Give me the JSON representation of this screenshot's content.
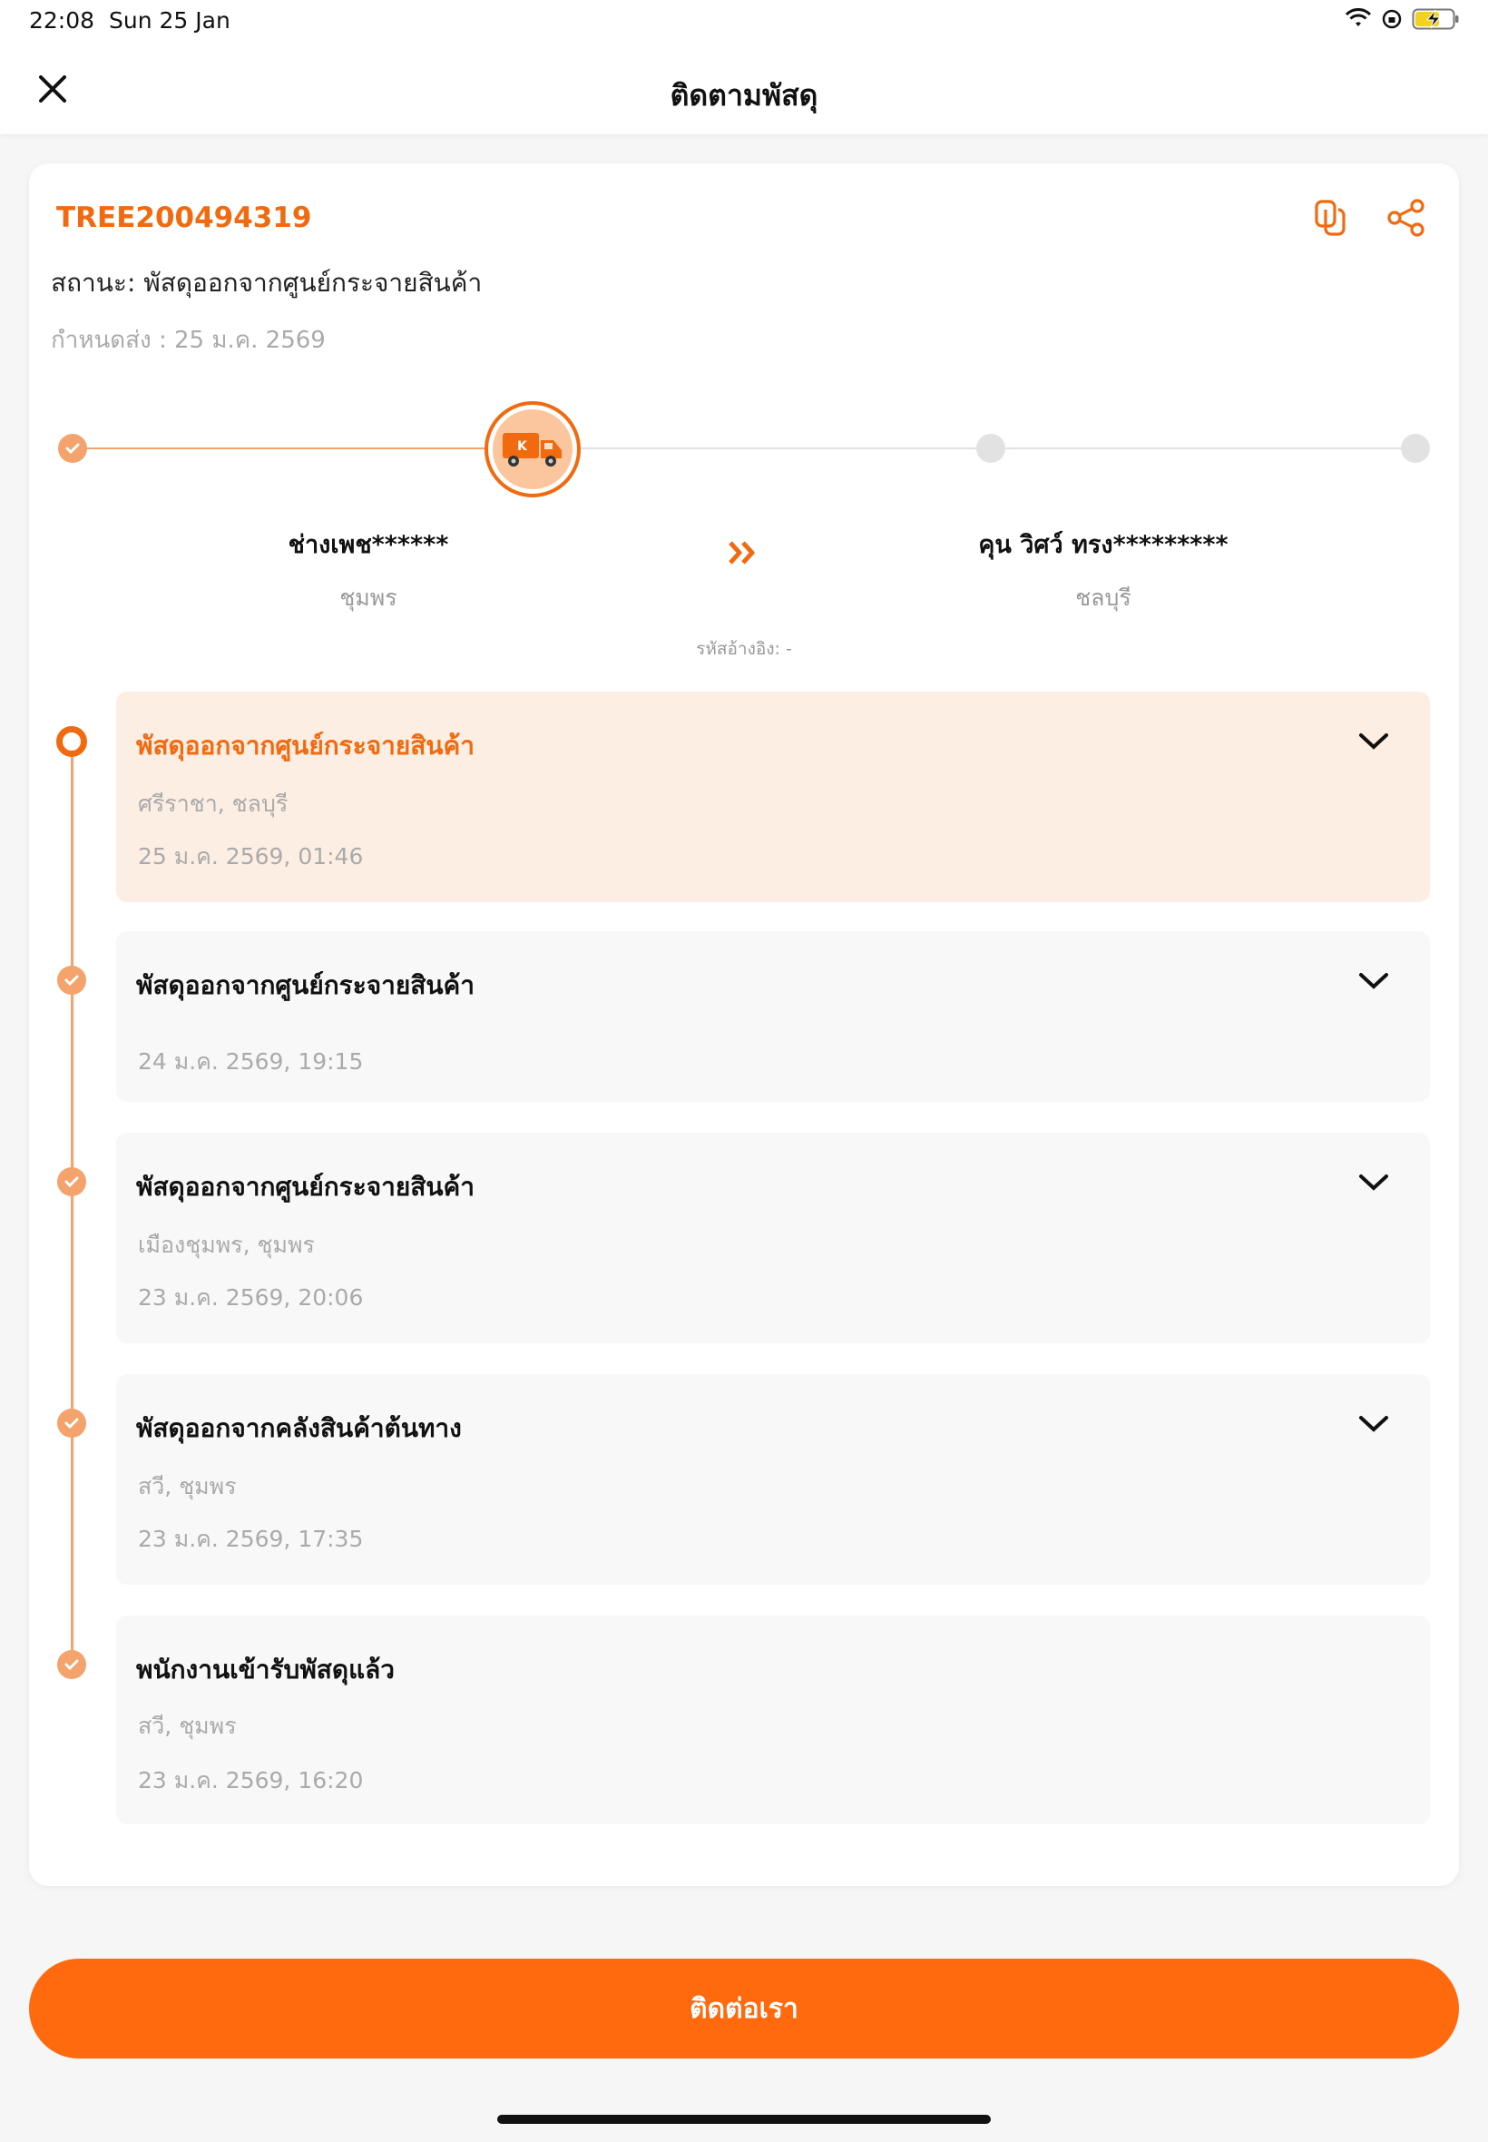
{
  "status_bar": {
    "time": "22:08",
    "date": "Sun 25 Jan"
  },
  "header": {
    "title": "ติดตามพัสดุ"
  },
  "parcel": {
    "tracking_number": "TREE200494319",
    "status": "สถานะ: พัสดุออกจากศูนย์กระจายสินค้า",
    "due": "กำหนดส่ง : 25 ม.ค. 2569"
  },
  "sender": {
    "name": "ช่างเพช******",
    "province": "ชุมพร"
  },
  "receiver": {
    "name": "คุน วิศว์ ทรง*********",
    "province": "ชลบุรี"
  },
  "reference": "รหัสอ้างอิง: -",
  "events": [
    {
      "title": "พัสดุออกจากศูนย์กระจายสินค้า",
      "location": "ศรีราชา, ชลบุรี",
      "time": "25 ม.ค. 2569, 01:46"
    },
    {
      "title": "พัสดุออกจากศูนย์กระจายสินค้า",
      "location": "",
      "time": "24 ม.ค. 2569, 19:15"
    },
    {
      "title": "พัสดุออกจากศูนย์กระจายสินค้า",
      "location": "เมืองชุมพร, ชุมพร",
      "time": "23 ม.ค. 2569, 20:06"
    },
    {
      "title": "พัสดุออกจากคลังสินค้าต้นทาง",
      "location": "สวี, ชุมพร",
      "time": "23 ม.ค. 2569, 17:35"
    },
    {
      "title": "พนักงานเข้ารับพัสดุแล้ว",
      "location": "สวี, ชุมพร",
      "time": "23 ม.ค. 2569, 16:20"
    }
  ],
  "contact_button": "ติดต่อเรา",
  "colors": {
    "accent": "#ff6a0e",
    "accent_light": "#f5a36d",
    "active_bg": "#fdeee4"
  }
}
